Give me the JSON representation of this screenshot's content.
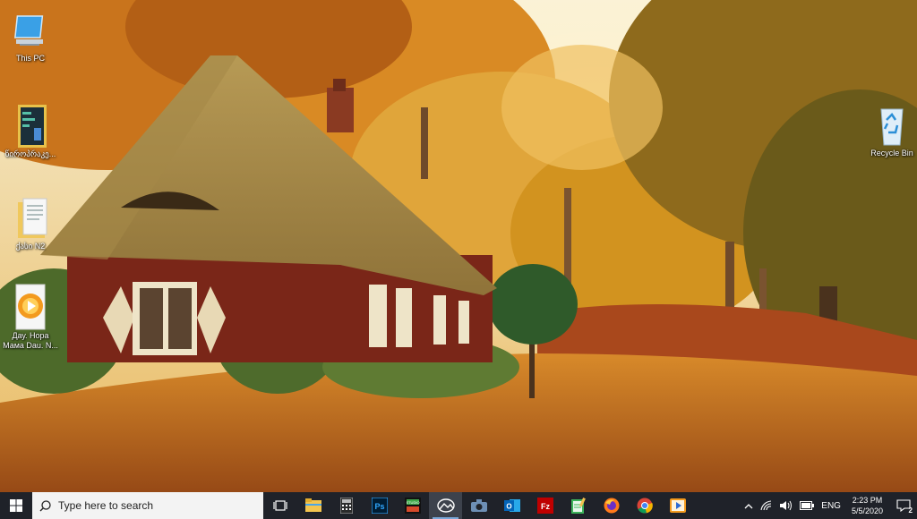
{
  "desktop_icons": [
    {
      "name": "This PC",
      "icon": "monitor-icon"
    },
    {
      "name": "წიროპრაკე...",
      "icon": "app-shortcut-icon"
    },
    {
      "name": "ქასი N2",
      "icon": "folder-icon"
    },
    {
      "name": "Дау. Нора\nМама Dau. N...",
      "icon": "media-file-icon"
    },
    {
      "name": "Recycle Bin",
      "icon": "recycle-bin-icon"
    }
  ],
  "taskbar": {
    "start_icon": "windows-logo-icon",
    "search_placeholder": "Type here to search",
    "apps": [
      {
        "name": "Task View",
        "icon": "task-view-icon",
        "running": false
      },
      {
        "name": "File Explorer",
        "icon": "folder-icon",
        "running": false
      },
      {
        "name": "Calculator",
        "icon": "calculator-icon",
        "running": false
      },
      {
        "name": "Photoshop",
        "icon": "photoshop-icon",
        "label": "Ps",
        "running": false
      },
      {
        "name": "Studio",
        "icon": "studio-icon",
        "label": "STUDIO",
        "running": false
      },
      {
        "name": "Photos",
        "icon": "photos-icon",
        "running": true,
        "active": true
      },
      {
        "name": "Camera",
        "icon": "camera-icon",
        "running": false
      },
      {
        "name": "Outlook",
        "icon": "outlook-icon",
        "label": "O",
        "running": false
      },
      {
        "name": "FileZilla",
        "icon": "filezilla-icon",
        "label": "Fz",
        "running": false
      },
      {
        "name": "Notepad",
        "icon": "notepad-icon",
        "running": false
      },
      {
        "name": "Firefox",
        "icon": "firefox-icon",
        "running": false
      },
      {
        "name": "Chrome",
        "icon": "chrome-icon",
        "running": false
      },
      {
        "name": "Media Player",
        "icon": "media-player-icon",
        "running": false
      }
    ]
  },
  "tray": {
    "chevron_icon": "chevron-up-icon",
    "network_icon": "wifi-icon",
    "volume_icon": "speaker-icon",
    "battery_icon": "battery-icon",
    "language": "ENG",
    "time": "2:23 PM",
    "date": "5/5/2020",
    "notification_count": "2",
    "notification_icon": "notification-icon"
  },
  "colors": {
    "taskbar_bg": "#1f2229",
    "search_bg": "#f3f3f3",
    "accent": "#7aa7d8"
  }
}
